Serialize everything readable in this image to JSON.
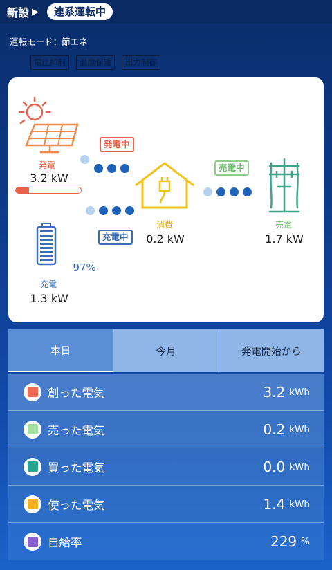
{
  "header": {
    "brand": "新設",
    "arrow": "▶",
    "status_pill": "連系運転中"
  },
  "mode_text": "運転モード：節エネ",
  "badges": [
    "電圧抑制",
    "温度保護",
    "出力制御"
  ],
  "flow": {
    "solar": {
      "label": "発電",
      "value": "3.2 kW",
      "tag": "発電中",
      "bar_fraction": 0.2
    },
    "battery": {
      "label": "充電",
      "value": "1.3 kW",
      "tag": "充電中",
      "percent": "97%"
    },
    "house": {
      "label": "消費",
      "value": "0.2 kW"
    },
    "grid": {
      "label": "売電",
      "value": "1.7 kW",
      "tag": "売電中"
    }
  },
  "tabs": [
    "本日",
    "今月",
    "発電開始から"
  ],
  "stats": [
    {
      "label": "創った電気",
      "value": "3.2",
      "unit": "kWh",
      "color": "#ef6a55"
    },
    {
      "label": "売った電気",
      "value": "0.2",
      "unit": "kWh",
      "color": "#a6e0a0"
    },
    {
      "label": "買った電気",
      "value": "0.0",
      "unit": "kWh",
      "color": "#2aa38e"
    },
    {
      "label": "使った電気",
      "value": "1.4",
      "unit": "kWh",
      "color": "#f2b21a"
    },
    {
      "label": "自給率",
      "value": "229",
      "unit": "%",
      "color": "#8a5fd1"
    }
  ],
  "colors": {
    "solar": "#e7624a",
    "house": "#f2c21a",
    "grid": "#3fa58a",
    "battery": "#3a6fb8",
    "flow_dot": "#1e63b8"
  }
}
